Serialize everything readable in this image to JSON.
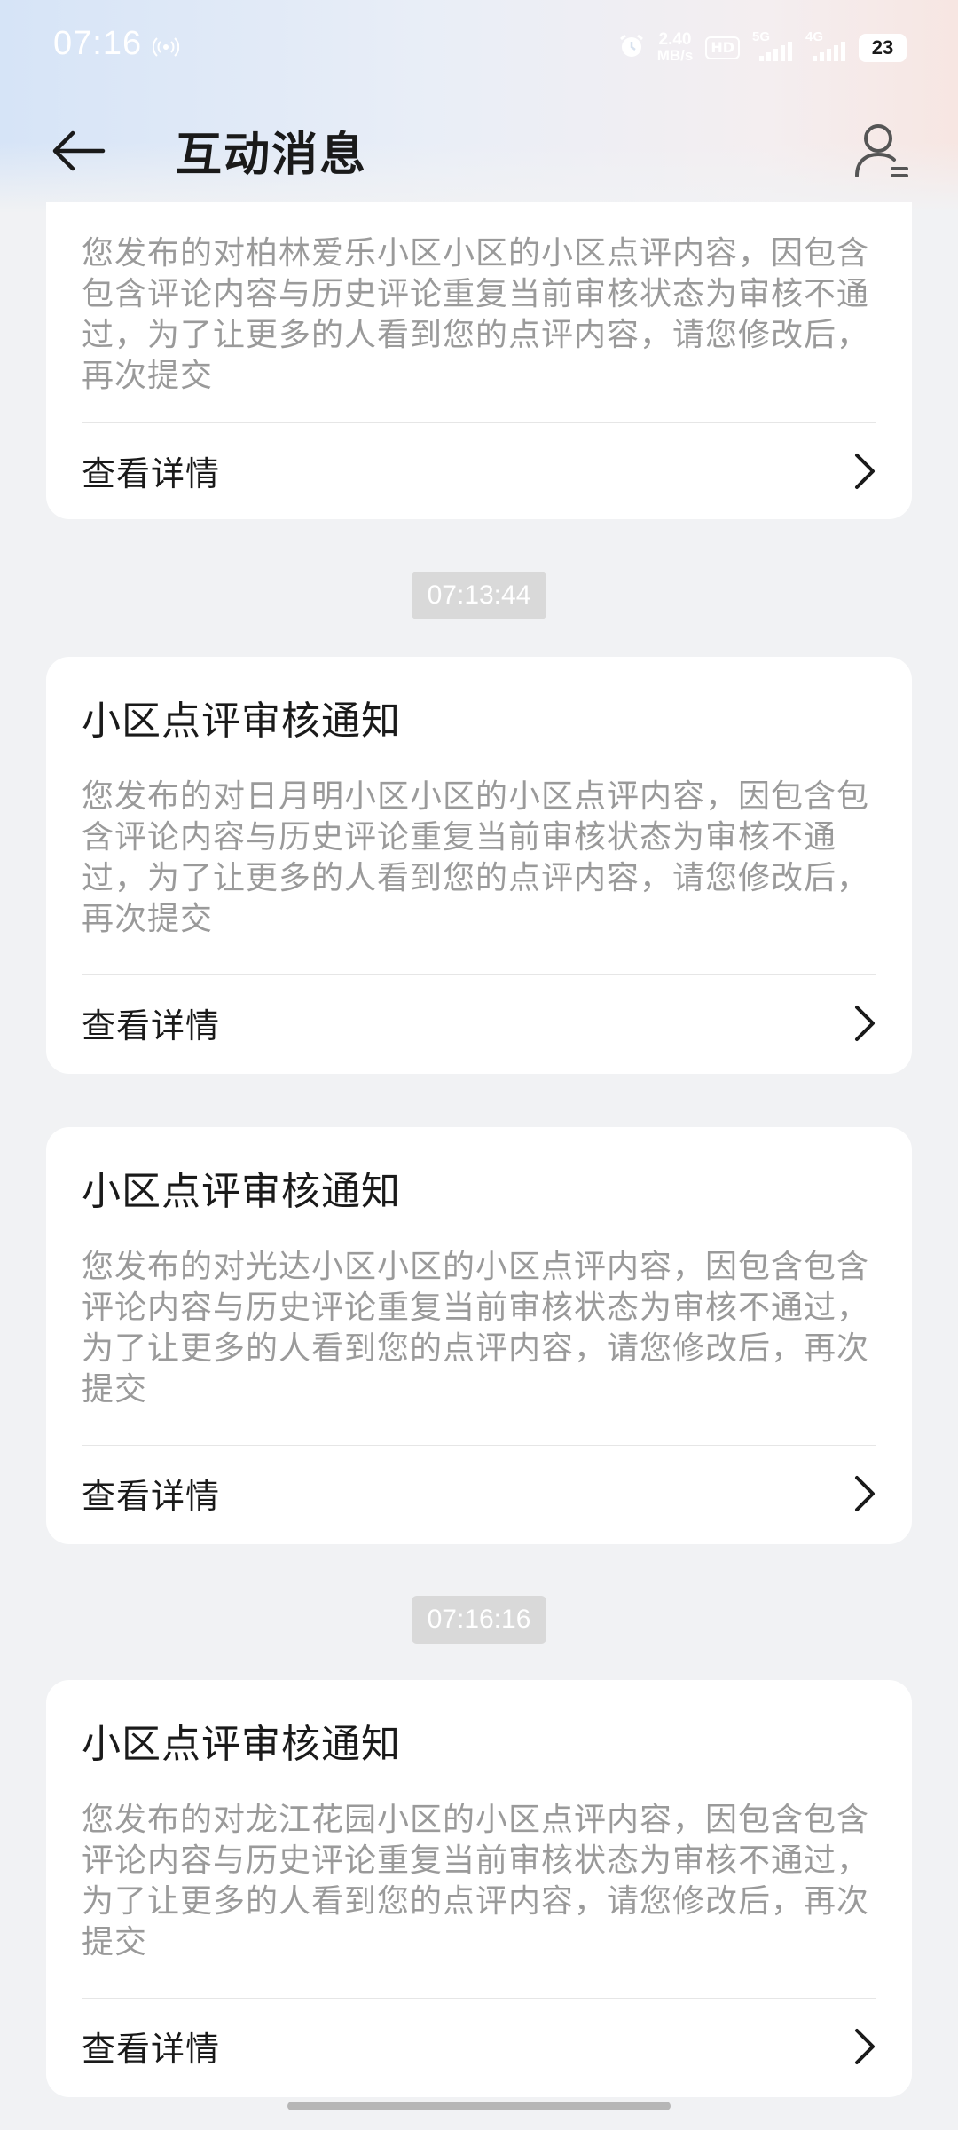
{
  "status_bar": {
    "time": "07:16",
    "net_speed_value": "2.40",
    "net_speed_unit": "MB/s",
    "hd_label": "HD",
    "net1_label": "5G",
    "net2_label": "4G",
    "battery": "23"
  },
  "header": {
    "title": "互动消息"
  },
  "messages": [
    {
      "body": "您发布的对柏林爱乐小区小区的小区点评内容，因包含包含评论内容与历史评论重复当前审核状态为审核不通过，为了让更多的人看到您的点评内容，请您修改后，再次提交",
      "action": "查看详情"
    },
    {
      "time": "07:13:44"
    },
    {
      "title": "小区点评审核通知",
      "body": "您发布的对日月明小区小区的小区点评内容，因包含包含评论内容与历史评论重复当前审核状态为审核不通过，为了让更多的人看到您的点评内容，请您修改后，再次提交",
      "action": "查看详情"
    },
    {
      "title": "小区点评审核通知",
      "body": "您发布的对光达小区小区的小区点评内容，因包含包含评论内容与历史评论重复当前审核状态为审核不通过，为了让更多的人看到您的点评内容，请您修改后，再次提交",
      "action": "查看详情"
    },
    {
      "time": "07:16:16"
    },
    {
      "title": "小区点评审核通知",
      "body": "您发布的对龙江花园小区的小区点评内容，因包含包含评论内容与历史评论重复当前审核状态为审核不通过，为了让更多的人看到您的点评内容，请您修改后，再次提交",
      "action": "查看详情"
    }
  ]
}
